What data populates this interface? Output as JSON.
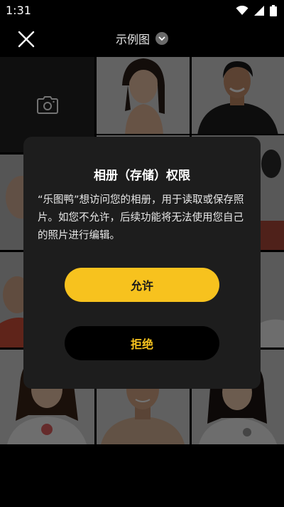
{
  "status": {
    "time": "1:31"
  },
  "header": {
    "title": "示例图"
  },
  "dialog": {
    "title": "相册（存储）权限",
    "message": "“乐图鸭”想访问您的相册，用于读取或保存照片。如您不允许，后续功能将无法使用您自己的照片进行编辑。",
    "allow_label": "允许",
    "deny_label": "拒绝"
  },
  "colors": {
    "accent": "#f7c21e",
    "dialog_bg": "#1d1d1d"
  }
}
